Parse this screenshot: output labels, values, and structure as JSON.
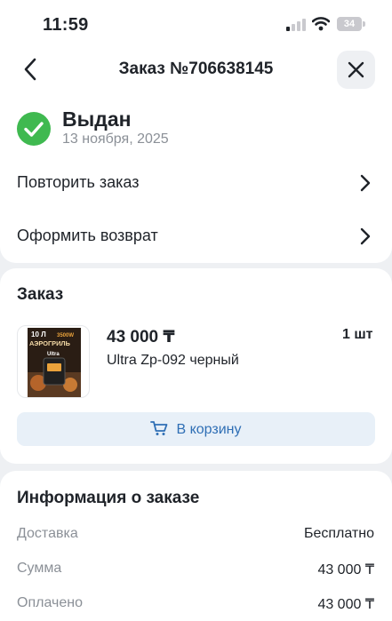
{
  "status_bar": {
    "time": "11:59",
    "battery": "34"
  },
  "header": {
    "title": "Заказ №706638145"
  },
  "order_status": {
    "title": "Выдан",
    "date": "13 ноября, 2025",
    "color": "#3fb950"
  },
  "actions": [
    {
      "label": "Повторить заказ"
    },
    {
      "label": "Оформить возврат"
    }
  ],
  "order": {
    "section_title": "Заказ",
    "product": {
      "price": "43 000 ₸",
      "quantity": "1 шт",
      "name": "Ultra Zp-092 черный",
      "image_text": {
        "volume": "10 Л",
        "power": "3500W",
        "type": "АЭРОГРИЛЬ",
        "brand": "Ultra"
      }
    },
    "cart_button": {
      "label": "В корзину",
      "icon": "cart-icon"
    }
  },
  "info": {
    "section_title": "Информация о заказе",
    "rows": [
      {
        "label": "Доставка",
        "value": "Бесплатно"
      },
      {
        "label": "Сумма",
        "value": "43 000 ₸"
      },
      {
        "label": "Оплачено",
        "value": "43 000 ₸"
      }
    ]
  },
  "colors": {
    "accent": "#2f6fb5",
    "button_bg": "#e8f0f8",
    "page_bg": "#eef0f3",
    "muted_text": "#8b9097"
  }
}
